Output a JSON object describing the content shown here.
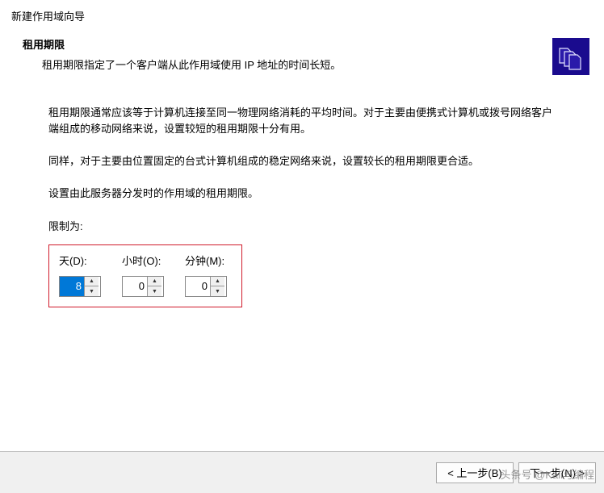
{
  "wizard": {
    "title": "新建作用域向导"
  },
  "header": {
    "heading": "租用期限",
    "description": "租用期限指定了一个客户端从此作用域使用 IP 地址的时间长短。"
  },
  "content": {
    "para1": "租用期限通常应该等于计算机连接至同一物理网络消耗的平均时间。对于主要由便携式计算机或拨号网络客户端组成的移动网络来说，设置较短的租用期限十分有用。",
    "para2": "同样，对于主要由位置固定的台式计算机组成的稳定网络来说，设置较长的租用期限更合适。",
    "para3": "设置由此服务器分发时的作用域的租用期限。",
    "limit_label": "限制为:"
  },
  "inputs": {
    "days": {
      "label": "天(D):",
      "value": "8"
    },
    "hours": {
      "label": "小时(O):",
      "value": "0"
    },
    "minutes": {
      "label": "分钟(M):",
      "value": "0"
    }
  },
  "buttons": {
    "back": "< 上一步(B)",
    "next": "下一步(N) >"
  },
  "watermark": "头条号 @Kali与编程"
}
